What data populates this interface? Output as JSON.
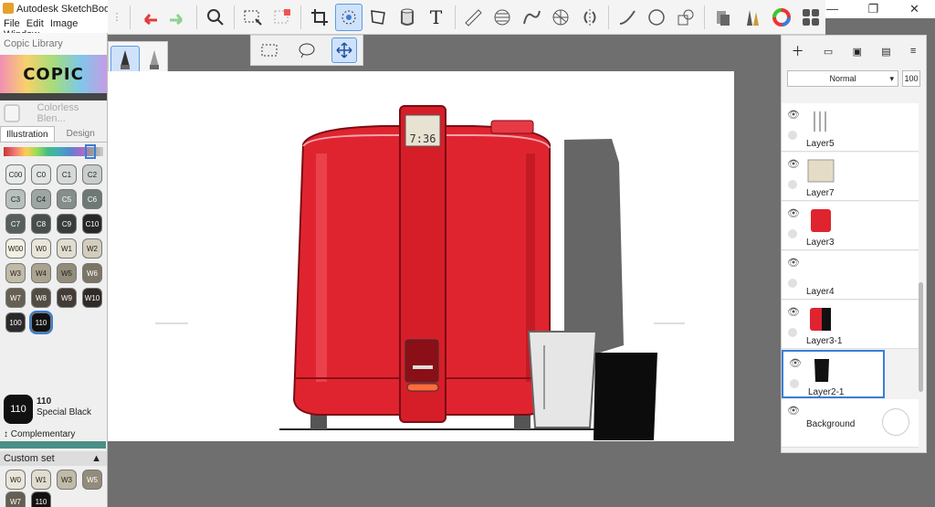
{
  "window": {
    "title": "Autodesk SketchBook",
    "minimize": "—",
    "restore": "❐",
    "close": "✕"
  },
  "menu": [
    "File",
    "Edit",
    "Image",
    "Window"
  ],
  "toolbar": {
    "tools": [
      "undo-icon",
      "redo-icon",
      "zoom-icon",
      "select-icon",
      "crop-select-icon",
      "crop-icon",
      "transform-icon",
      "distort-icon",
      "fill-icon",
      "text-icon",
      "ruler-icon",
      "ellipse-icon",
      "curve-icon",
      "perspective-icon",
      "symmetry-icon",
      "line-icon",
      "circle-icon",
      "shapes-icon",
      "copic-icon",
      "brushes-icon",
      "color-wheel-icon",
      "brush-library-icon"
    ],
    "active_tool": "transform-icon",
    "subtools": [
      "rect-select-icon",
      "lasso-icon",
      "move-icon"
    ]
  },
  "copic": {
    "header": "Copic Library",
    "logo": "COPIC",
    "colorless": "Colorless Blen...",
    "tabs": [
      "Illustration",
      "Design"
    ],
    "swatches": [
      {
        "code": "C00",
        "color": "#e7ebe8"
      },
      {
        "code": "C0",
        "color": "#e0e4e2"
      },
      {
        "code": "C1",
        "color": "#d5dad8"
      },
      {
        "code": "C2",
        "color": "#c7cecb"
      },
      {
        "code": "C3",
        "color": "#b8c0bd"
      },
      {
        "code": "C4",
        "color": "#9da6a3"
      },
      {
        "code": "C5",
        "color": "#848e8b"
      },
      {
        "code": "C6",
        "color": "#6e7875"
      },
      {
        "code": "C7",
        "color": "#575f5d"
      },
      {
        "code": "C8",
        "color": "#474e4c"
      },
      {
        "code": "C9",
        "color": "#383d3c"
      },
      {
        "code": "C10",
        "color": "#252827"
      },
      {
        "code": "W00",
        "color": "#f2efe3"
      },
      {
        "code": "W0",
        "color": "#e9e6d9"
      },
      {
        "code": "W1",
        "color": "#e1ddce"
      },
      {
        "code": "W2",
        "color": "#d2cdbd"
      },
      {
        "code": "W3",
        "color": "#c0baa7"
      },
      {
        "code": "W4",
        "color": "#aaa390"
      },
      {
        "code": "W5",
        "color": "#938c7a"
      },
      {
        "code": "W6",
        "color": "#7c7565"
      },
      {
        "code": "W7",
        "color": "#675f52"
      },
      {
        "code": "W8",
        "color": "#534c42"
      },
      {
        "code": "W9",
        "color": "#433c34"
      },
      {
        "code": "W10",
        "color": "#302b26"
      },
      {
        "code": "100",
        "color": "#2a2a2a"
      },
      {
        "code": "110",
        "color": "#111111"
      }
    ],
    "selected": "110",
    "current_code": "110",
    "current_name": "Special Black",
    "complementary": "Complementary",
    "custom_set": "Custom set",
    "custom_swatches": [
      {
        "code": "W0",
        "color": "#e9e6d9"
      },
      {
        "code": "W1",
        "color": "#e1ddce"
      },
      {
        "code": "W3",
        "color": "#c0baa7"
      },
      {
        "code": "W5",
        "color": "#938c7a"
      },
      {
        "code": "W7",
        "color": "#675f52"
      },
      {
        "code": "110",
        "color": "#111111"
      }
    ]
  },
  "brushes": {
    "count_label": "2"
  },
  "canvas": {
    "clock_display": "7:36",
    "product_color": "#e0242f"
  },
  "layers": {
    "blend_mode": "Normal",
    "opacity": "100",
    "items": [
      {
        "name": "Layer5"
      },
      {
        "name": "Layer7"
      },
      {
        "name": "Layer3"
      },
      {
        "name": "Layer4"
      },
      {
        "name": "Layer3-1"
      },
      {
        "name": "Layer2-1"
      },
      {
        "name": "Background"
      }
    ],
    "active": "Layer2-1"
  }
}
